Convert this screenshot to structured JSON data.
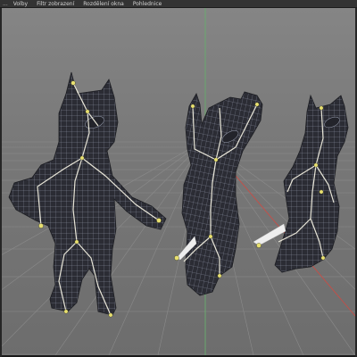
{
  "window": {
    "menu_items": [
      "...",
      "Volby",
      "Filtr zobrazení",
      "Rozdělení okna",
      "Pohlednice"
    ]
  },
  "viewport": {
    "label": "3D viewport",
    "background_color": "#7a7a7a",
    "grid_color": "#8a8a8a",
    "mesh_color": "#2b2c34",
    "wire_color": "#aeb4c4",
    "bone_color": "#f2efe0",
    "joint_color": "#e8e070",
    "y_axis_color": "#63b36a",
    "x_axis_color": "#d04a42",
    "characters": [
      "cat-pose-1",
      "cat-pose-2",
      "cat-pose-3"
    ]
  }
}
